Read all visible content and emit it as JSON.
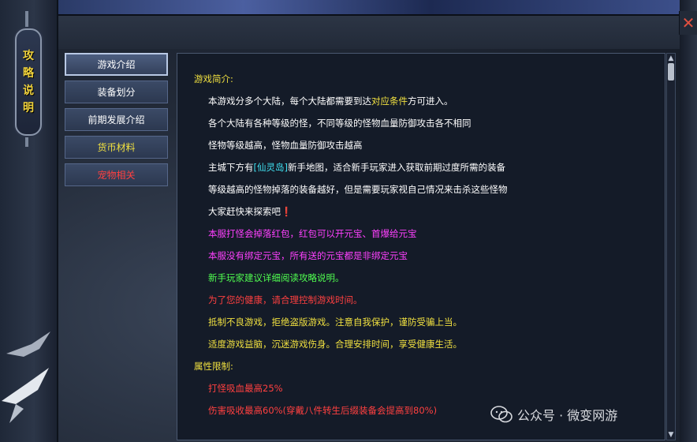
{
  "window": {
    "title_chars": [
      "攻",
      "略",
      "说",
      "明"
    ],
    "close_glyph": "✕"
  },
  "menu": [
    {
      "label": "游戏介绍",
      "color": "#ffffff",
      "active": true
    },
    {
      "label": "装备划分",
      "color": "#ffffff",
      "active": false
    },
    {
      "label": "前期发展介绍",
      "color": "#ffffff",
      "active": false
    },
    {
      "label": "货币材料",
      "color": "#f0e040",
      "active": false
    },
    {
      "label": "宠物相关",
      "color": "#ff4040",
      "active": false
    }
  ],
  "content": {
    "intro_heading": "游戏简介:",
    "intro_lines": [
      {
        "parts": [
          {
            "text": "本游戏分多个大陆，每个大陆都需要到达",
            "color": "#ffffff"
          },
          {
            "text": "对应条件",
            "color": "#f0e040"
          },
          {
            "text": "方可进入。",
            "color": "#ffffff"
          }
        ]
      },
      {
        "parts": [
          {
            "text": "各个大陆有各种等级的怪，不同等级的怪物血量防御攻击各不相同",
            "color": "#ffffff"
          }
        ]
      },
      {
        "parts": [
          {
            "text": "怪物等级越高，怪物血量防御攻击越高",
            "color": "#ffffff"
          }
        ]
      },
      {
        "parts": [
          {
            "text": "主城下方有",
            "color": "#ffffff"
          },
          {
            "text": "[仙灵岛]",
            "color": "#40e0f0"
          },
          {
            "text": "新手地图，适合新手玩家进入获取前期过度所需的装备",
            "color": "#ffffff"
          }
        ]
      },
      {
        "parts": [
          {
            "text": "等级越高的怪物掉落的装备越好，但是需要玩家视自己情况来击杀这些怪物",
            "color": "#ffffff"
          }
        ]
      },
      {
        "parts": [
          {
            "text": "大家赶快来探索吧❗",
            "color": "#ffffff"
          }
        ]
      },
      {
        "parts": [
          {
            "text": "本服打怪会掉落红包，红包可以开元宝、首爆给元宝",
            "color": "#ff40ff"
          }
        ]
      },
      {
        "parts": [
          {
            "text": "本服没有绑定元宝，所有送的元宝都是非绑定元宝",
            "color": "#ff40ff"
          }
        ]
      },
      {
        "parts": [
          {
            "text": "新手玩家建议详细阅读攻略说明。",
            "color": "#50ff50"
          }
        ]
      },
      {
        "parts": [
          {
            "text": "为了您的健康，请合理控制游戏时间。",
            "color": "#ff4040"
          }
        ]
      },
      {
        "parts": [
          {
            "text": "抵制不良游戏，拒绝盗版游戏。注意自我保护，谨防受骗上当。",
            "color": "#f0e040"
          }
        ]
      },
      {
        "parts": [
          {
            "text": "适度游戏益脑，沉迷游戏伤身。合理安排时间，享受健康生活。",
            "color": "#f0e040"
          }
        ]
      }
    ],
    "attr_heading": "属性限制:",
    "attr_lines": [
      {
        "parts": [
          {
            "text": "打怪吸血最高25%",
            "color": "#ff4040"
          }
        ]
      },
      {
        "parts": [
          {
            "text": "伤害吸收最高60%(穿戴八件转生后缀装备会提高到80%)",
            "color": "#ff4040"
          }
        ]
      }
    ],
    "heading_color": "#f0e040"
  },
  "watermark": {
    "text": "公众号 · 微变网游"
  }
}
